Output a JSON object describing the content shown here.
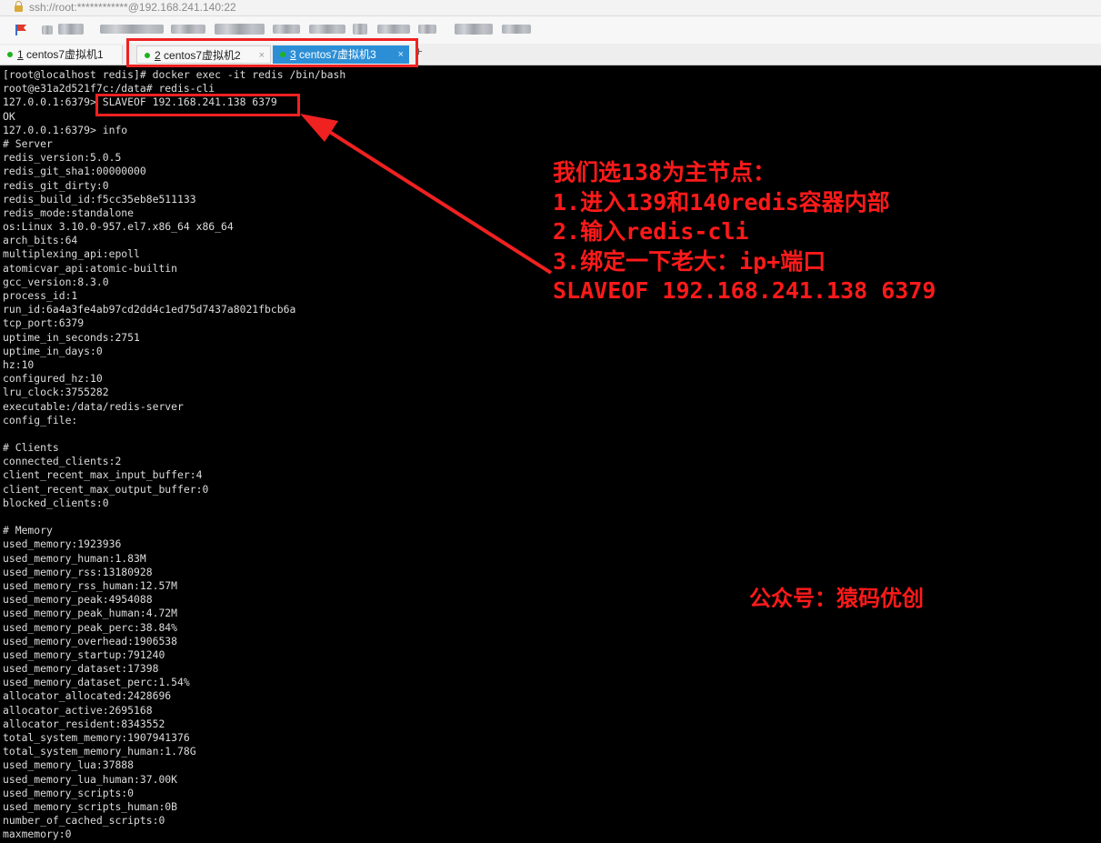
{
  "window": {
    "address": "ssh://root:************@192.168.241.140:22"
  },
  "tabs": [
    {
      "num": "1",
      "label": " centos7虚拟机1",
      "close": ""
    },
    {
      "num": "2",
      "label": " centos7虚拟机2",
      "close": "×"
    },
    {
      "num": "3",
      "label": " centos7虚拟机3",
      "close": "×"
    }
  ],
  "tab_new": "+",
  "terminal": {
    "lines": [
      "[root@localhost redis]# docker exec -it redis /bin/bash",
      "root@e31a2d521f7c:/data# redis-cli",
      "127.0.0.1:6379> SLAVEOF 192.168.241.138 6379",
      "OK",
      "127.0.0.1:6379> info",
      "# Server",
      "redis_version:5.0.5",
      "redis_git_sha1:00000000",
      "redis_git_dirty:0",
      "redis_build_id:f5cc35eb8e511133",
      "redis_mode:standalone",
      "os:Linux 3.10.0-957.el7.x86_64 x86_64",
      "arch_bits:64",
      "multiplexing_api:epoll",
      "atomicvar_api:atomic-builtin",
      "gcc_version:8.3.0",
      "process_id:1",
      "run_id:6a4a3fe4ab97cd2dd4c1ed75d7437a8021fbcb6a",
      "tcp_port:6379",
      "uptime_in_seconds:2751",
      "uptime_in_days:0",
      "hz:10",
      "configured_hz:10",
      "lru_clock:3755282",
      "executable:/data/redis-server",
      "config_file:",
      "",
      "# Clients",
      "connected_clients:2",
      "client_recent_max_input_buffer:4",
      "client_recent_max_output_buffer:0",
      "blocked_clients:0",
      "",
      "# Memory",
      "used_memory:1923936",
      "used_memory_human:1.83M",
      "used_memory_rss:13180928",
      "used_memory_rss_human:12.57M",
      "used_memory_peak:4954088",
      "used_memory_peak_human:4.72M",
      "used_memory_peak_perc:38.84%",
      "used_memory_overhead:1906538",
      "used_memory_startup:791240",
      "used_memory_dataset:17398",
      "used_memory_dataset_perc:1.54%",
      "allocator_allocated:2428696",
      "allocator_active:2695168",
      "allocator_resident:8343552",
      "total_system_memory:1907941376",
      "total_system_memory_human:1.78G",
      "used_memory_lua:37888",
      "used_memory_lua_human:37.00K",
      "used_memory_scripts:0",
      "used_memory_scripts_human:0B",
      "number_of_cached_scripts:0",
      "maxmemory:0"
    ]
  },
  "annotation": {
    "lines": [
      "我们选138为主节点：",
      "1.进入139和140redis容器内部",
      "2.输入redis-cli",
      "3.绑定一下老大：ip+端口",
      "SLAVEOF 192.168.241.138 6379"
    ]
  },
  "watermark": "公众号：猿码优创",
  "colors": {
    "annotation_red": "#ff1a1a",
    "tab_active": "#2c8fd6",
    "terminal_bg": "#000000",
    "terminal_fg": "#dcdcdc",
    "status_dot": "#1db31d"
  }
}
